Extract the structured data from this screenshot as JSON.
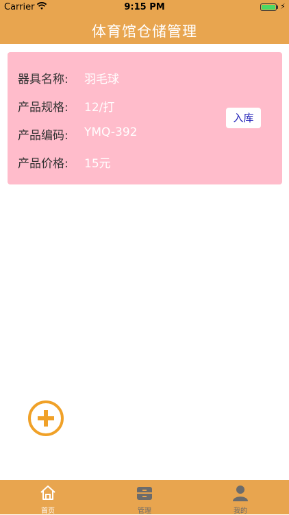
{
  "status_bar": {
    "carrier": "Carrier",
    "time": "9:15 PM",
    "battery_percent": 100
  },
  "nav": {
    "title": "体育馆仓储管理"
  },
  "item_card": {
    "fields": [
      {
        "label": "器具名称:",
        "value": "羽毛球"
      },
      {
        "label": "产品规格:",
        "value": "12/打"
      },
      {
        "label": "产品编码:",
        "value": "YMQ-392"
      },
      {
        "label": "产品价格:",
        "value": "15元"
      }
    ],
    "stock_in_label": "入库"
  },
  "add_button": {
    "icon": "plus-circle-icon"
  },
  "tab_bar": {
    "tabs": [
      {
        "label": "首页",
        "icon": "home-icon",
        "active": true
      },
      {
        "label": "管理",
        "icon": "drawer-icon",
        "active": false
      },
      {
        "label": "我的",
        "icon": "person-icon",
        "active": false
      }
    ]
  },
  "colors": {
    "accent": "#e8a54f",
    "card_background": "#ffbccb",
    "add_button": "#f0a128"
  }
}
